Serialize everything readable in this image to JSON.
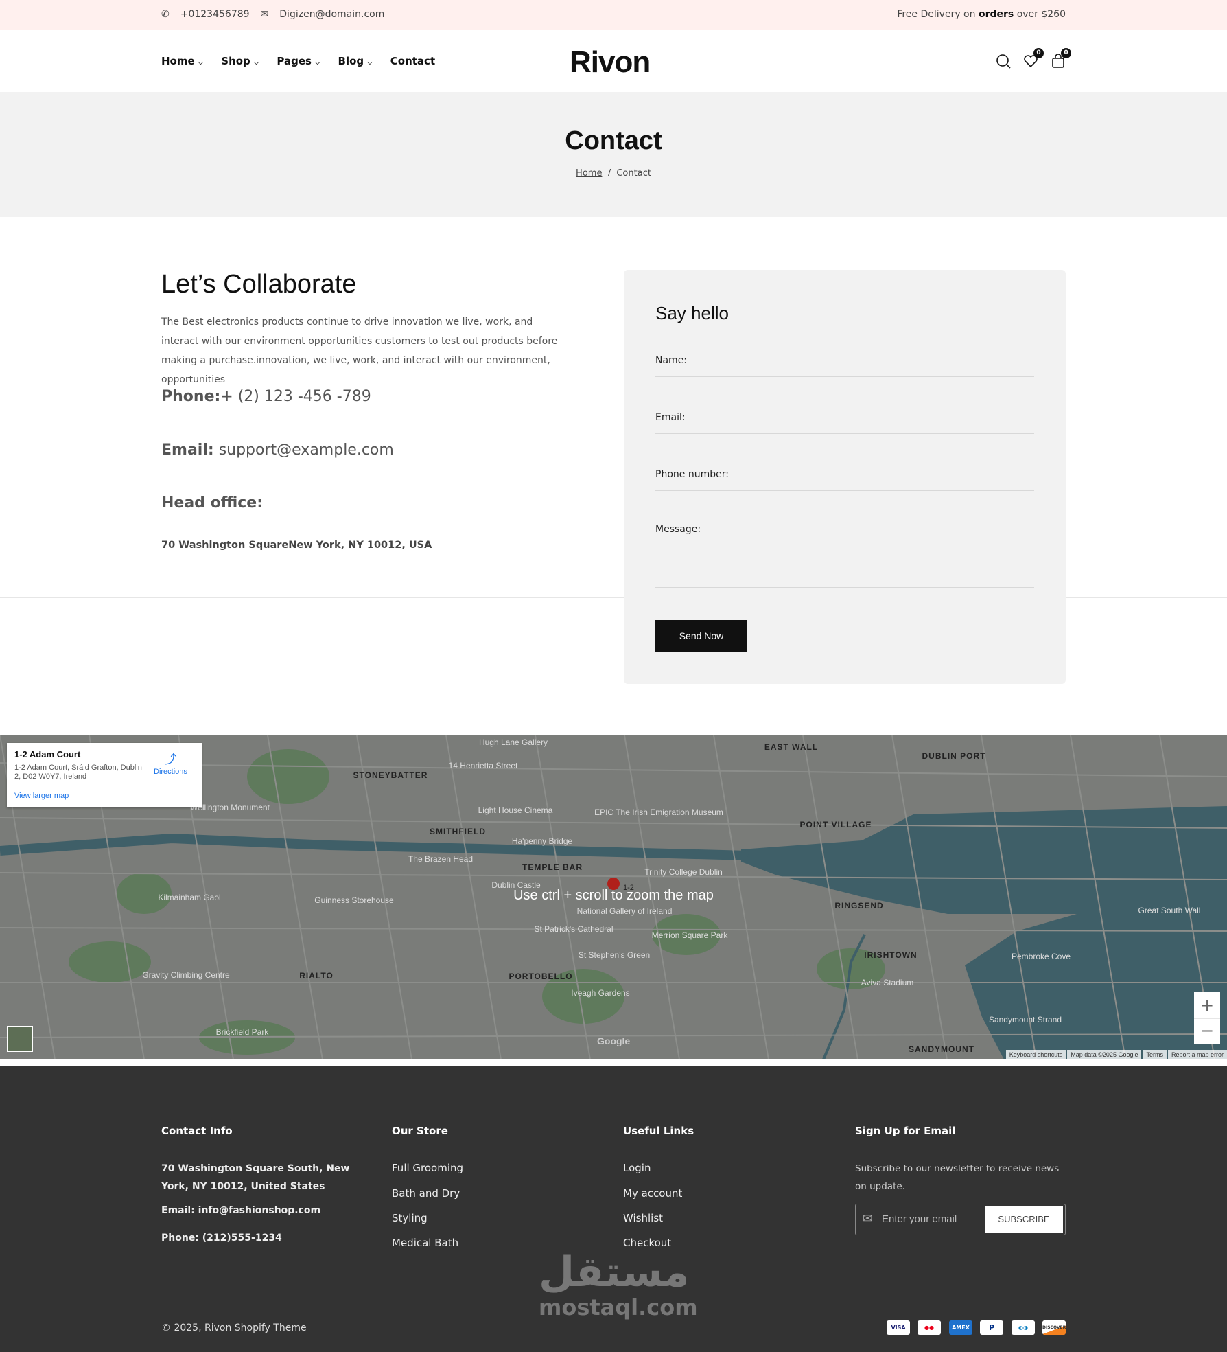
{
  "topbar": {
    "phone": "+0123456789",
    "email": "Digizen@domain.com",
    "delivery_prefix": "Free Delivery on",
    "delivery_bold": "orders",
    "delivery_suffix": "over $260"
  },
  "header": {
    "logo": "Rivon",
    "nav": [
      {
        "label": "Home",
        "dropdown": true
      },
      {
        "label": "Shop",
        "dropdown": true
      },
      {
        "label": "Pages",
        "dropdown": true
      },
      {
        "label": "Blog",
        "dropdown": true
      },
      {
        "label": "Contact",
        "dropdown": false
      }
    ],
    "wishlist_count": "0",
    "cart_count": "0"
  },
  "hero": {
    "title": "Contact",
    "breadcrumb": [
      "Home",
      "/",
      "Contact"
    ]
  },
  "contact": {
    "heading": "Let’s Collaborate",
    "paragraph": "The Best electronics products continue to drive innovation we live, work, and interact with our environment opportunities customers to test out products before making a purchase.innovation, we live, work, and interact with our environment, opportunities",
    "phone_label": "Phone:+",
    "phone_value": "(2) 123 -456 -789",
    "email_label": "Email:",
    "email_value": "support@example.com",
    "office_label": "Head office:",
    "address": "70 Washington SquareNew York, NY 10012, USA"
  },
  "form": {
    "title": "Say hello",
    "fields": [
      "Name:",
      "Email:",
      "Phone number:",
      "Message:"
    ],
    "submit": "Send Now"
  },
  "map": {
    "card": {
      "title": "1-2 Adam Court",
      "address": "1-2 Adam Court, Sráid Grafton, Dublin 2, D02 W0Y7, Ireland",
      "directions": "Directions",
      "larger": "View larger map"
    },
    "overlay": "Use ctrl + scroll to zoom the map",
    "pin_label": "1-2",
    "labels": [
      "EAST WALL",
      "DUBLIN PORT",
      "STONEYBATTER",
      "SMITHFIELD",
      "POINT VILLAGE",
      "TEMPLE BAR",
      "RINGSEND",
      "IRISHTOWN",
      "RIALTO",
      "PORTOBELLO",
      "SANDYMOUNT",
      "Kilmainham Gaol",
      "Guinness Storehouse",
      "Trinity College Dublin",
      "St Patrick's Cathedral",
      "Aviva Stadium",
      "Pembroke Cove",
      "Gravity Climbing Centre",
      "Brickfield Park",
      "Hugh Lane Gallery",
      "14 Henrietta Street",
      "Light House Cinema",
      "Wellington Monument",
      "The Brazen Head",
      "Dublin Castle",
      "Ha'penny Bridge",
      "Merrion Square Park",
      "Iveagh Gardens",
      "Great South Wall",
      "Sandymount Strand",
      "St Stephen's Green",
      "National Gallery of Ireland",
      "EPIC The Irish Emigration Museum"
    ],
    "attribution": [
      "Keyboard shortcuts",
      "Map data ©2025 Google",
      "Terms",
      "Report a map error"
    ],
    "google": "Google",
    "zoom_in": "+",
    "zoom_out": "−",
    "colors": {
      "land": "#7a7c79",
      "water": "#3f5f68",
      "park": "#5f7a5c"
    }
  },
  "footer": {
    "contact": {
      "title": "Contact Info",
      "address": "70 Washington Square South, New York, NY 10012, United States",
      "email": "Email: info@fashionshop.com",
      "phone": "Phone: (212)555-1234"
    },
    "store": {
      "title": "Our Store",
      "items": [
        "Full Grooming",
        "Bath and Dry",
        "Styling",
        "Medical Bath"
      ]
    },
    "links": {
      "title": "Useful Links",
      "items": [
        "Login",
        "My account",
        "Wishlist",
        "Checkout"
      ]
    },
    "signup": {
      "title": "Sign Up for Email",
      "text": "Subscribe to our newsletter to receive news on update.",
      "placeholder": "Enter your email",
      "button": "SUBSCRIBE"
    },
    "copyright": "© 2025, Rivon Shopify Theme",
    "payments": [
      "VISA",
      "MC",
      "AMEX",
      "P",
      "DC",
      "DISCOVER"
    ],
    "watermark_ar": "مستقل",
    "watermark": "mostaql.com"
  }
}
